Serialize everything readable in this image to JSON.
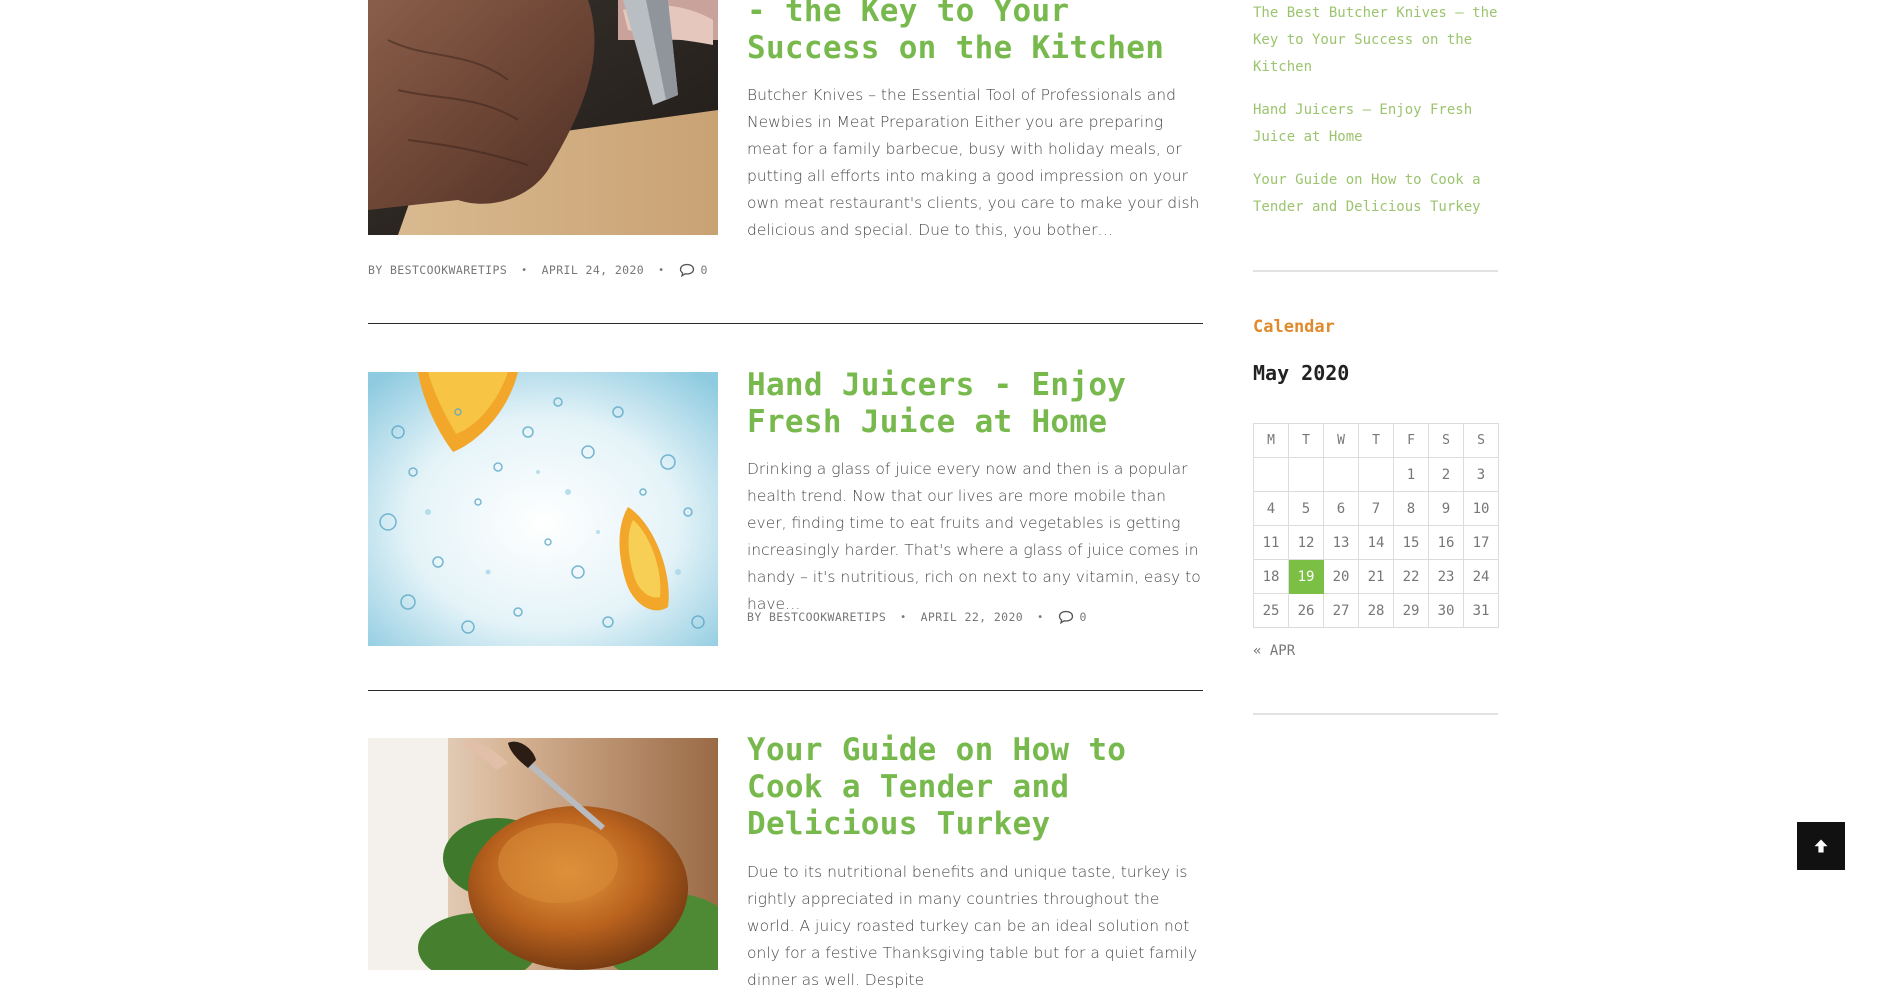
{
  "posts": [
    {
      "title_line1": "- the Key to Your",
      "title_line2": "Success on the Kitchen",
      "excerpt": "Butcher Knives – the Essential Tool of Professionals and Newbies in Meat Preparation Either you are preparing meat for a family barbecue, busy with holiday meals, or putting all efforts into making a good impression on your own meat restaurant's clients, you care to make your dish delicious and special. Due to this, you bother…",
      "author": "BY BESTCOOKWARETIPS",
      "date": "APRIL 24, 2020",
      "comments": "0",
      "image_icon": "butcher-knife-photo"
    },
    {
      "title_line1": "Hand Juicers - Enjoy",
      "title_line2": "Fresh Juice at Home",
      "excerpt": "Drinking a glass of juice every now and then is a popular health trend. Now that our lives are more mobile than ever, finding time to eat fruits and vegetables is getting increasingly harder. That's where a glass of juice comes in handy – it's nutritious, rich on next to any vitamin, easy to have…",
      "author": "BY BESTCOOKWARETIPS",
      "date": "APRIL 22, 2020",
      "comments": "0",
      "image_icon": "juice-splash-photo"
    },
    {
      "title_line1": "Your Guide on How to",
      "title_line2": "Cook a Tender and",
      "title_line3": "Delicious Turkey",
      "excerpt": "Due to its nutritional benefits and unique taste, turkey is rightly appreciated in many countries throughout the world. A juicy roasted turkey can be an ideal solution not only for a festive Thanksgiving table but for a quiet family dinner as well. Despite",
      "image_icon": "roast-turkey-photo"
    }
  ],
  "sidebar": {
    "recent_posts": [
      {
        "line1": "The Best Butcher Knives – the",
        "line2": "Key to Your Success on the",
        "line3": "Kitchen"
      },
      {
        "line1": "Hand Juicers – Enjoy Fresh",
        "line2": "Juice at Home"
      },
      {
        "line1": "Your Guide on How to Cook a",
        "line2": "Tender and Delicious Turkey"
      }
    ],
    "calendar": {
      "widget_title": "Calendar",
      "caption": "May 2020",
      "weekdays": [
        "M",
        "T",
        "W",
        "T",
        "F",
        "S",
        "S"
      ],
      "weeks": [
        [
          "",
          "",
          "",
          "",
          "1",
          "2",
          "3"
        ],
        [
          "4",
          "5",
          "6",
          "7",
          "8",
          "9",
          "10"
        ],
        [
          "11",
          "12",
          "13",
          "14",
          "15",
          "16",
          "17"
        ],
        [
          "18",
          "19",
          "20",
          "21",
          "22",
          "23",
          "24"
        ],
        [
          "25",
          "26",
          "27",
          "28",
          "29",
          "30",
          "31"
        ]
      ],
      "today": "19",
      "prev_link": "« APR"
    }
  },
  "colors": {
    "title_green": "#78b94d",
    "link_green": "#9cc46e",
    "widget_orange": "#e08a2b",
    "today_bg": "#7cbf45"
  },
  "back_to_top": {
    "icon": "arrow-up-icon"
  }
}
